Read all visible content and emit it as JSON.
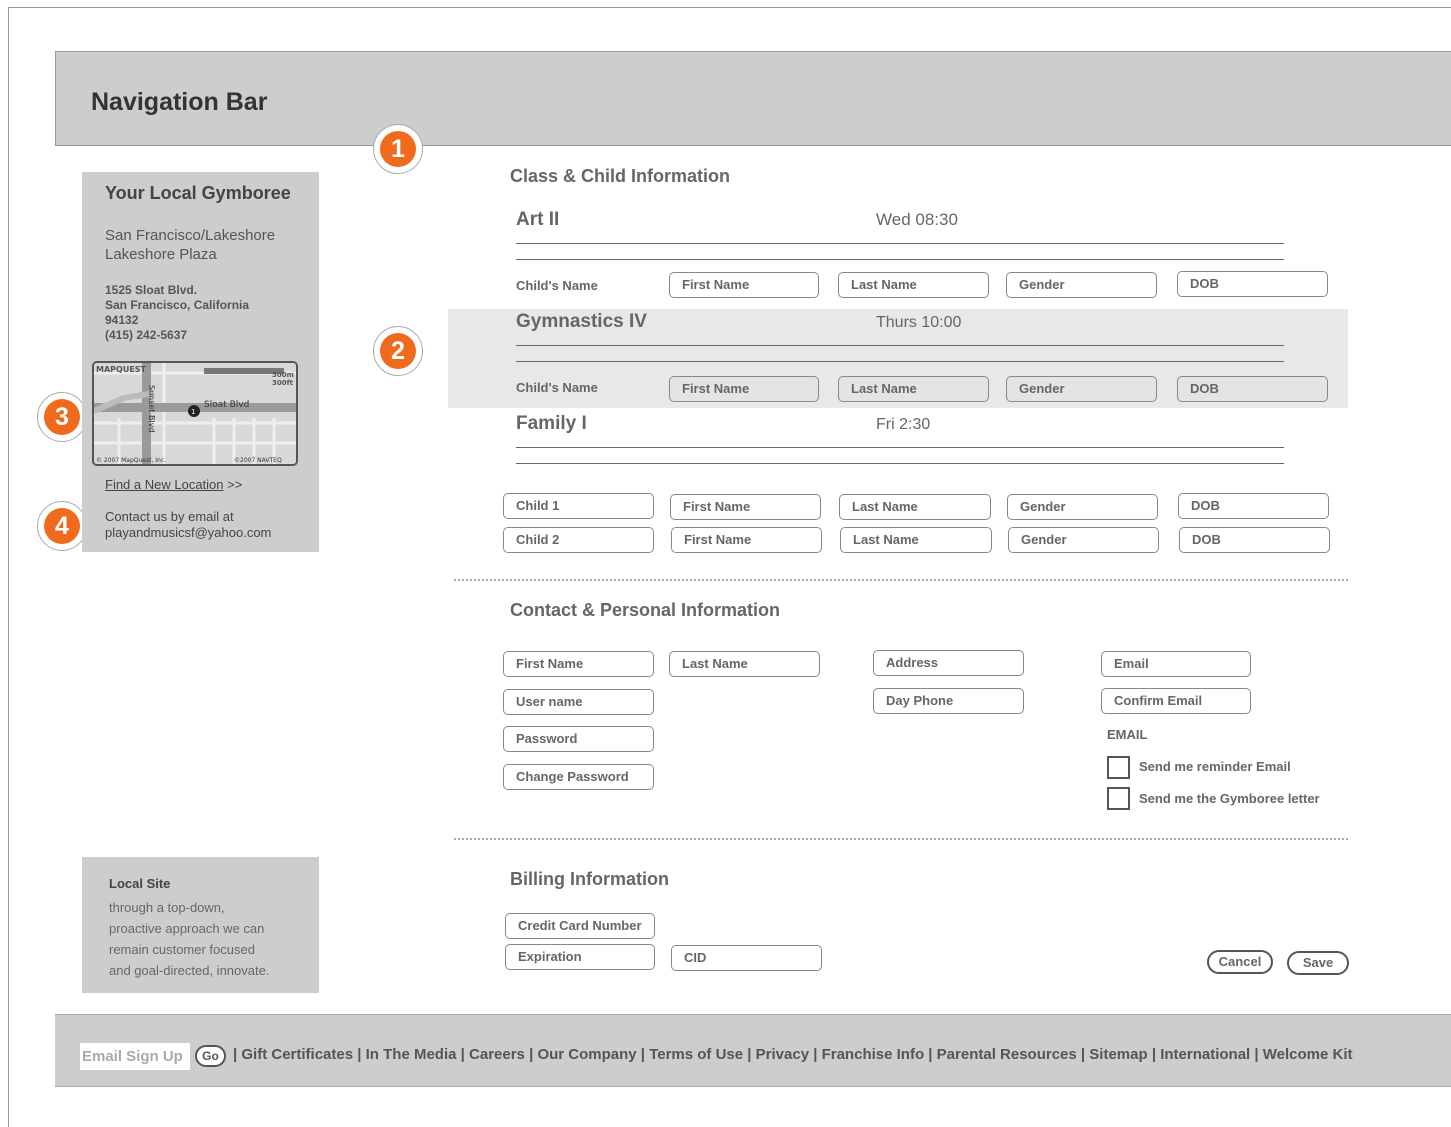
{
  "nav": {
    "title": "Navigation Bar"
  },
  "badges": [
    "1",
    "2",
    "3",
    "4"
  ],
  "left_panel": {
    "title": "Your Local Gymboree",
    "location_line1": "San Francisco/Lakeshore",
    "location_line2": "Lakeshore Plaza",
    "address_line1": "1525 Sloat Blvd.",
    "address_line2": "San Francisco, California",
    "address_line3": "94132",
    "phone": "(415) 242-5637",
    "map": {
      "brand": "MAPQUEST",
      "scale_m": "300m",
      "scale_ft": "300ft",
      "street1": "Sloat Blvd",
      "street2": "Sunset Blvd",
      "marker": "1",
      "copyright_left": "© 2007 MapQuest, Inc.",
      "copyright_right": "©2007 NAVTEQ"
    },
    "find_link": "Find a New Location",
    "find_suffix": " >>",
    "contact_line1": "Contact us by email at",
    "contact_line2": "playandmusicsf@yahoo.com"
  },
  "local_site": {
    "title": "Local Site",
    "line1": "through a top-down,",
    "line2": "proactive approach we can",
    "line3": "remain customer focused",
    "line4": "and goal-directed, innovate."
  },
  "class_section": {
    "title": "Class & Child Information",
    "child_name_label": "Child's Name",
    "classes": [
      {
        "name": "Art II",
        "time": "Wed 08:30"
      },
      {
        "name": "Gymnastics IV",
        "time": "Thurs 10:00"
      },
      {
        "name": "Family I",
        "time": "Fri 2:30"
      }
    ],
    "fields": {
      "first": "First Name",
      "last": "Last Name",
      "gender": "Gender",
      "dob": "DOB"
    },
    "child1": "Child 1",
    "child2": "Child 2"
  },
  "contact_section": {
    "title": "Contact & Personal Information",
    "first_name": "First Name",
    "last_name": "Last Name",
    "user_name": "User name",
    "password": "Password",
    "change_password": "Change Password",
    "address": "Address",
    "day_phone": "Day Phone",
    "email": "Email",
    "confirm_email": "Confirm Email",
    "email_heading": "EMAIL",
    "reminder": "Send me reminder Email",
    "letter": "Send me the Gymboree letter"
  },
  "billing_section": {
    "title": "Billing Information",
    "card": "Credit Card Number",
    "expiration": "Expiration",
    "cid": "CID"
  },
  "buttons": {
    "cancel": "Cancel",
    "save": "Save"
  },
  "footer": {
    "email_signup": "Email Sign Up",
    "go": "Go",
    "links": [
      "Gift Certificates",
      "In The Media",
      "Careers",
      "Our Company",
      "Terms of Use",
      "Privacy",
      "Franchise Info",
      "Parental Resources",
      "Sitemap",
      "International",
      "Welcome Kit"
    ]
  }
}
